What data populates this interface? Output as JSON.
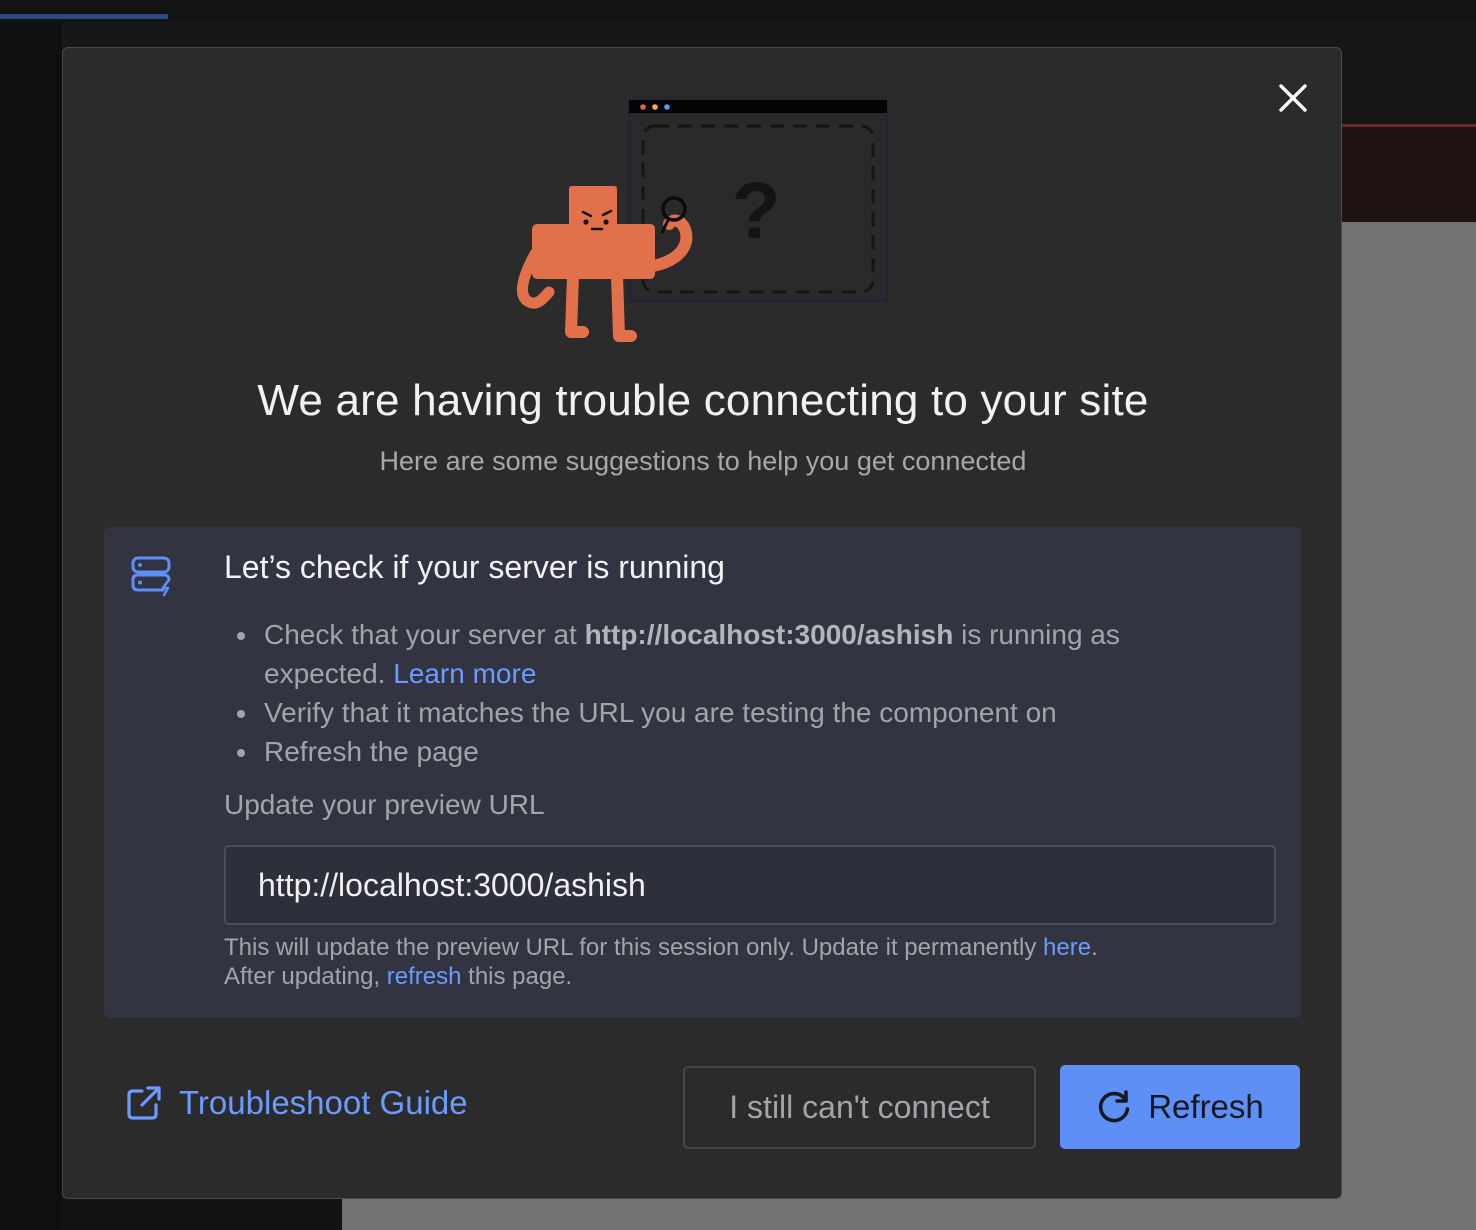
{
  "modal": {
    "close_icon": "close-icon",
    "title": "We are having trouble connecting to your site",
    "subtitle": "Here are some suggestions to help you get connected"
  },
  "server_check": {
    "icon": "server-icon",
    "heading": "Let’s check if your server is running",
    "tip1_pre": "Check that your server at ",
    "tip1_url": "http://localhost:3000/ashish",
    "tip1_post": " is running as expected. ",
    "tip1_link": "Learn more",
    "tip2": "Verify that it matches the URL you are testing the component on",
    "tip3": "Refresh the page"
  },
  "preview_url": {
    "label": "Update your preview URL",
    "value": "http://localhost:3000/ashish",
    "help_pre": "This will update the preview URL for this session only. Update it permanently ",
    "help_link1": "here",
    "help_mid": ".",
    "help_line2_pre": "After updating, ",
    "help_link2": "refresh",
    "help_post": " this page."
  },
  "footer": {
    "troubleshoot_icon": "external-link-icon",
    "troubleshoot_label": "Troubleshoot Guide",
    "cant_connect_label": "I still can't connect",
    "refresh_icon": "refresh-icon",
    "refresh_label": "Refresh"
  },
  "colors": {
    "accent": "#5d8ff7",
    "link": "#6b9bff",
    "modal_bg": "#2b2b2c",
    "panel_bg": "#323441",
    "mascot": "#e2704a"
  }
}
